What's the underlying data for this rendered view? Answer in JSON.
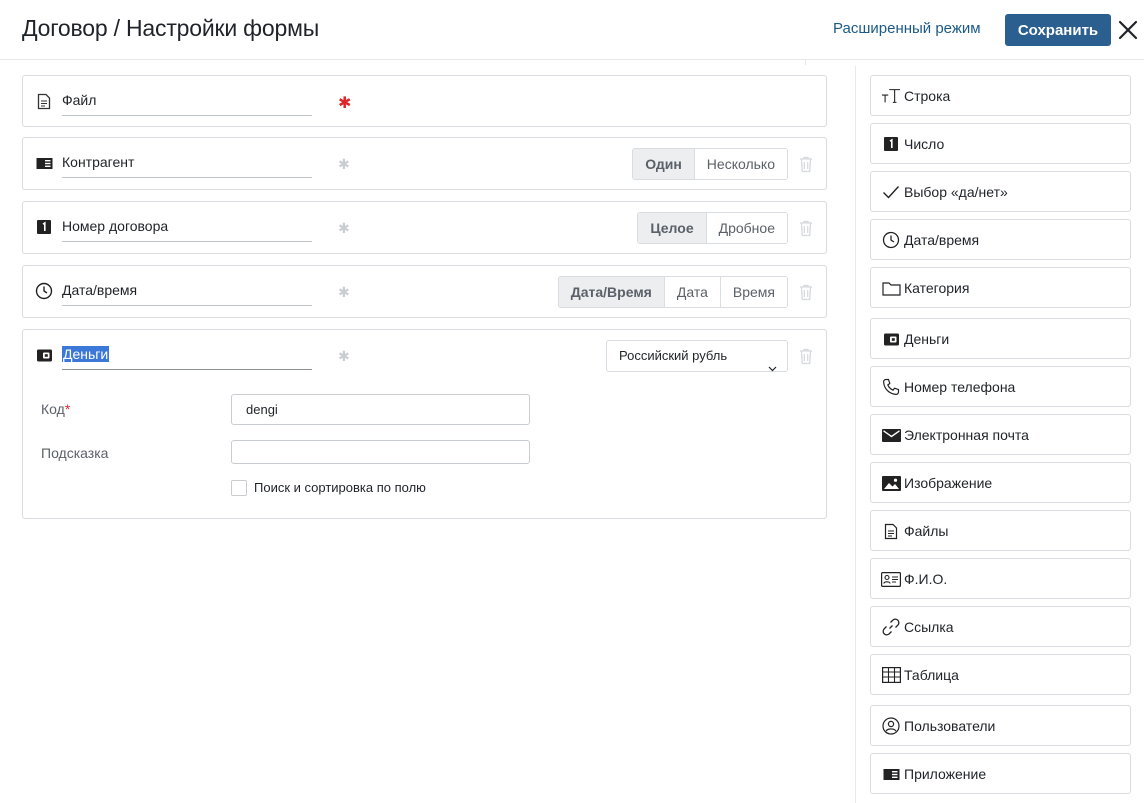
{
  "header": {
    "title": "Договор / Настройки формы",
    "advanced_mode_label": "Расширенный режим",
    "save_label": "Сохранить",
    "accent_color": "#2b5f90",
    "link_color": "#1c5a86"
  },
  "fields": [
    {
      "label": "Файл",
      "icon": "file-icon",
      "required": true
    },
    {
      "label": "Контрагент",
      "icon": "app-icon",
      "required": false,
      "options": [
        "Один",
        "Несколько"
      ],
      "active_option": "Один"
    },
    {
      "label": "Номер договора",
      "icon": "number-icon",
      "required": false,
      "options": [
        "Целое",
        "Дробное"
      ],
      "active_option": "Целое"
    },
    {
      "label": "Дата/время",
      "icon": "clock-icon",
      "required": false,
      "options": [
        "Дата/Время",
        "Дата",
        "Время"
      ],
      "active_option": "Дата/Время"
    },
    {
      "label": "Деньги",
      "icon": "wallet-icon",
      "required": false,
      "currency": "Российский рубль",
      "settings": {
        "code_label": "Код",
        "code_value": "dengi",
        "hint_label": "Подсказка",
        "hint_value": "",
        "search_sort_label": "Поиск и сортировка по полю"
      }
    }
  ],
  "field_types": [
    {
      "label": "Строка",
      "icon": "text-icon"
    },
    {
      "label": "Число",
      "icon": "number-icon"
    },
    {
      "label": "Выбор «да/нет»",
      "icon": "check-icon"
    },
    {
      "label": "Дата/время",
      "icon": "clock-icon"
    },
    {
      "label": "Категория",
      "icon": "folder-icon"
    },
    {
      "label": "Деньги",
      "icon": "wallet-icon"
    },
    {
      "label": "Номер телефона",
      "icon": "phone-icon"
    },
    {
      "label": "Электронная почта",
      "icon": "mail-icon"
    },
    {
      "label": "Изображение",
      "icon": "image-icon"
    },
    {
      "label": "Файлы",
      "icon": "file-icon"
    },
    {
      "label": "Ф.И.О.",
      "icon": "id-card-icon"
    },
    {
      "label": "Ссылка",
      "icon": "link-icon"
    },
    {
      "label": "Таблица",
      "icon": "table-icon"
    },
    {
      "label": "Пользователи",
      "icon": "user-icon"
    },
    {
      "label": "Приложение",
      "icon": "app-icon"
    }
  ]
}
